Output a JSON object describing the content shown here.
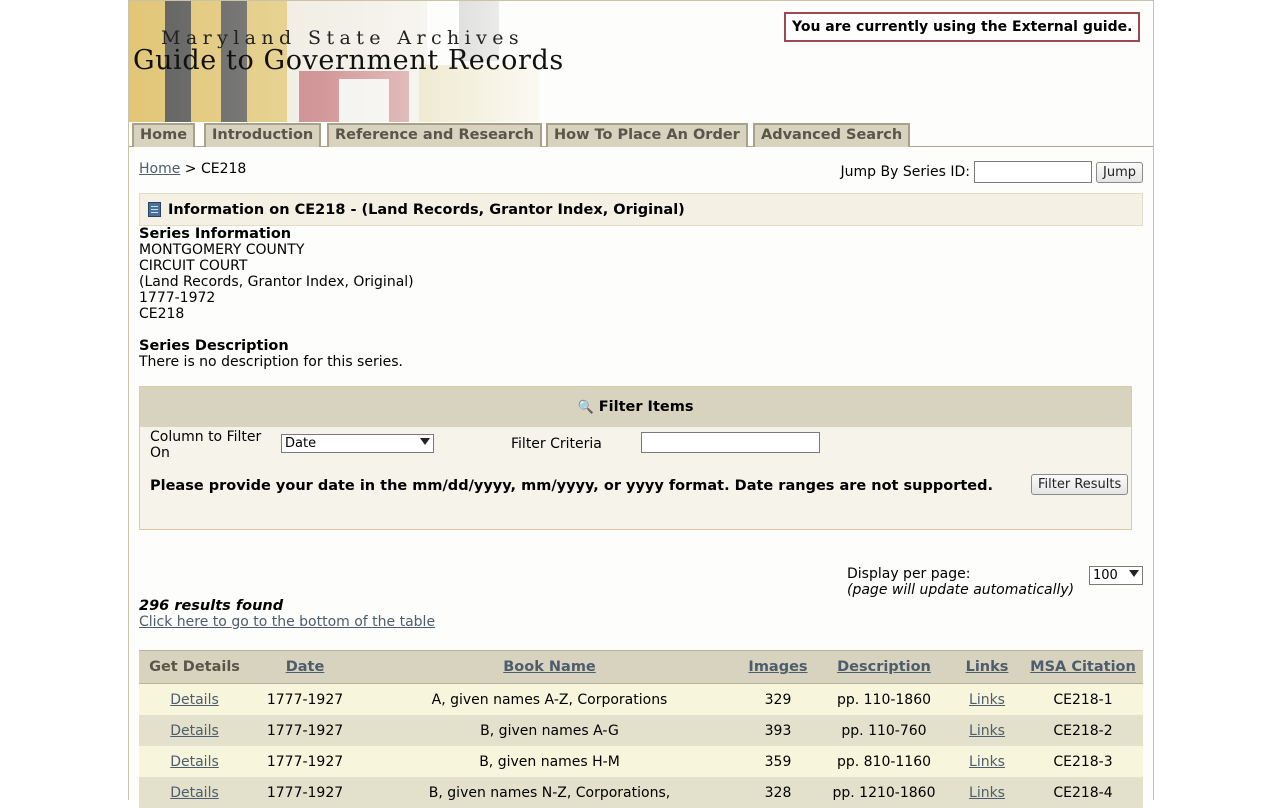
{
  "banner": {
    "archives_name": "Maryland State Archives",
    "guide_title": "Guide to Government Records",
    "notice": "You are currently using the External guide.",
    "flag_colors": {
      "gold": "#d8b44a",
      "black": "#2a2a2a",
      "red": "#a8383c",
      "white": "#f2efe6"
    }
  },
  "nav": {
    "tabs": [
      "Home",
      "Introduction",
      "Reference and Research",
      "How To Place An Order",
      "Advanced Search"
    ]
  },
  "breadcrumb": {
    "home": "Home",
    "separator": ">",
    "current": "CE218"
  },
  "jump": {
    "label": "Jump By Series ID:",
    "button": "Jump",
    "value": ""
  },
  "info": {
    "icon": "book-icon",
    "header": "Information on CE218 - (Land Records, Grantor Index, Original)",
    "series_info_heading": "Series Information",
    "series_info_lines": [
      "MONTGOMERY COUNTY",
      "CIRCUIT COURT",
      "(Land Records, Grantor Index, Original)",
      "1777-1972",
      "CE218"
    ],
    "series_desc_heading": "Series Description",
    "series_desc_text": "There is no description for this series."
  },
  "filter": {
    "icon": "magnifier-icon",
    "title": "Filter Items",
    "column_label": "Column to Filter On",
    "column_selected": "Date",
    "criteria_label": "Filter Criteria",
    "criteria_value": "",
    "note": "Please provide your date in the mm/dd/yyyy, mm/yyyy, or yyyy format. Date ranges are not supported.",
    "button": "Filter Results"
  },
  "results": {
    "display_label": "Display per page:",
    "display_sub": "(page will update automatically)",
    "per_page": "100",
    "count_text": "296 results found",
    "bottom_link": "Click here to go to the bottom of the table"
  },
  "table": {
    "columns": [
      "Get Details",
      "Date",
      "Book Name",
      "Images",
      "Description",
      "Links",
      "MSA Citation"
    ],
    "rows": [
      {
        "details": "Details",
        "date": "1777-1927",
        "book": "A, given names A-Z, Corporations",
        "images": "329",
        "description": "pp. 110-1860",
        "links": "Links",
        "citation": "CE218-1"
      },
      {
        "details": "Details",
        "date": "1777-1927",
        "book": "B, given names A-G",
        "images": "393",
        "description": "pp. 110-760",
        "links": "Links",
        "citation": "CE218-2"
      },
      {
        "details": "Details",
        "date": "1777-1927",
        "book": "B, given names H-M",
        "images": "359",
        "description": "pp. 810-1160",
        "links": "Links",
        "citation": "CE218-3"
      },
      {
        "details": "Details",
        "date": "1777-1927",
        "book": "B, given names N-Z, Corporations,",
        "images": "328",
        "description": "pp. 1210-1860",
        "links": "Links",
        "citation": "CE218-4"
      }
    ]
  }
}
